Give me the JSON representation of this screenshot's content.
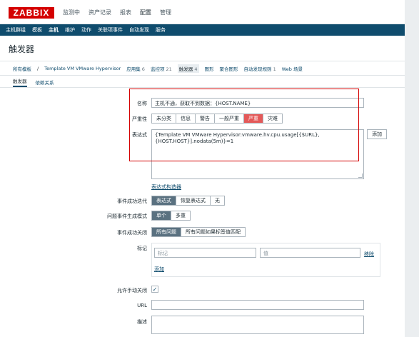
{
  "logo": "ZABBIX",
  "main_menu": [
    "监测中",
    "资产记录",
    "报表",
    "配置",
    "管理"
  ],
  "main_menu_active": 3,
  "sub_menu": [
    "主机群组",
    "模板",
    "主机",
    "维护",
    "动作",
    "关联项事件",
    "自动发现",
    "服务"
  ],
  "sub_menu_active": 2,
  "page_title": "触发器",
  "breadcrumb": {
    "all_templates": "所有模板",
    "separator": "/",
    "template": "Template VM VMware Hypervisor",
    "items": [
      {
        "label": "应用集",
        "count": "6"
      },
      {
        "label": "监控项",
        "count": "21"
      },
      {
        "label": "触发器",
        "count": "4"
      },
      {
        "label": "图形",
        "count": ""
      },
      {
        "label": "聚合图形",
        "count": ""
      },
      {
        "label": "自动发现规则",
        "count": "1"
      },
      {
        "label": "Web 场景",
        "count": ""
      }
    ]
  },
  "tabs": [
    "触发器",
    "依赖关系"
  ],
  "form": {
    "name_label": "名称",
    "name_value": "主机不通，获取不到数据：{HOST.NAME}",
    "severity_label": "严重性",
    "severity_options": [
      "未分类",
      "信息",
      "警告",
      "一般严重",
      "严重",
      "灾难"
    ],
    "severity_selected": 4,
    "expression_label": "表达式",
    "expression_line1": "{Template VM VMware Hypervisor:vmware.hv.cpu.usage[{$URL},",
    "expression_line2": "{HOST.HOST}].nodata(5m)}=1",
    "add_button": "添加",
    "expression_builder": "表达式构造器",
    "ok_event_gen_label": "事件成功迭代",
    "ok_event_gen_options": [
      "表达式",
      "恢复表达式",
      "无"
    ],
    "ok_event_gen_selected": 0,
    "problem_mode_label": "问题事件生成模式",
    "problem_mode_options": [
      "单个",
      "多重"
    ],
    "problem_mode_selected": 0,
    "ok_close_label": "事件成功关闭",
    "ok_close_options": [
      "所有问题",
      "所有问题如果标签值匹配"
    ],
    "ok_close_selected": 0,
    "tags_label": "标记",
    "tag_placeholder": "标记",
    "value_placeholder": "值",
    "remove_link": "移除",
    "add_link": "添加",
    "manual_close_label": "允许手动关闭",
    "manual_close_checked": "✓",
    "url_label": "URL",
    "description_label": "描述"
  },
  "colors": {
    "brand_red": "#d40000",
    "nav_blue": "#0f4c6d",
    "severity_high": "#e45959",
    "selected_gray": "#5a7180"
  }
}
